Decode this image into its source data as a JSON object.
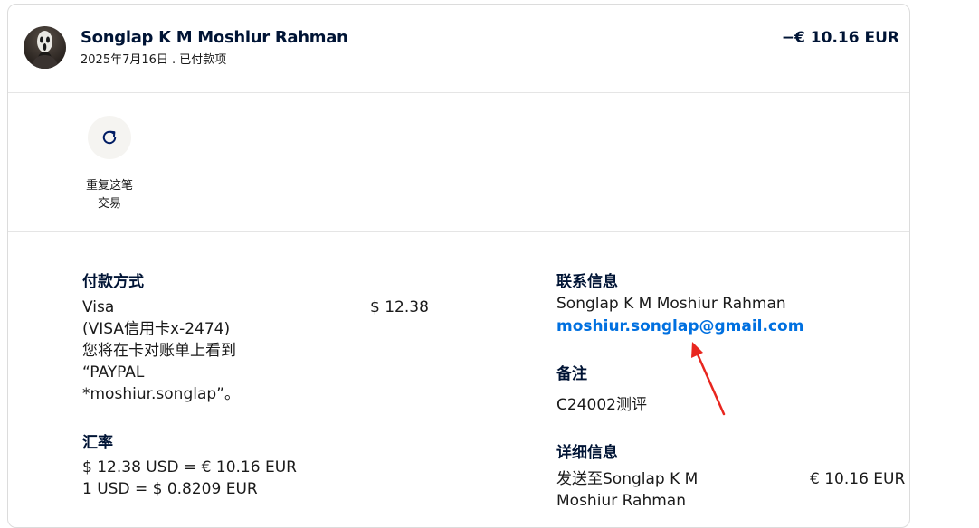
{
  "header": {
    "name": "Songlap K M Moshiur Rahman",
    "subline": "2025年7月16日 . 已付款项",
    "amount": "−€ 10.16 EUR"
  },
  "actions": {
    "repeat_label_line1": "重复这笔",
    "repeat_label_line2": "交易",
    "repeat_icon": "refresh-icon"
  },
  "payment": {
    "heading": "付款方式",
    "method": "Visa",
    "card": "(VISA信用卡x-2474)",
    "note_line1": "您将在卡对账单上看到",
    "note_line2": "“PAYPAL",
    "note_line3": "*moshiur.songlap”。",
    "amount": "$ 12.38"
  },
  "exchange": {
    "heading": "汇率",
    "line1": "$ 12.38 USD = € 10.16 EUR",
    "line2": "1 USD = $ 0.8209 EUR"
  },
  "contact": {
    "heading": "联系信息",
    "name": "Songlap K M Moshiur Rahman",
    "email": "moshiur.songlap@gmail.com"
  },
  "remark": {
    "heading": "备注",
    "text": "C24002测评"
  },
  "detail": {
    "heading": "详细信息",
    "line1": "发送至Songlap K M",
    "line2": "Moshiur Rahman",
    "amount": "€ 10.16 EUR"
  },
  "colors": {
    "link": "#0070e0",
    "annotation_arrow": "#e8261f"
  }
}
